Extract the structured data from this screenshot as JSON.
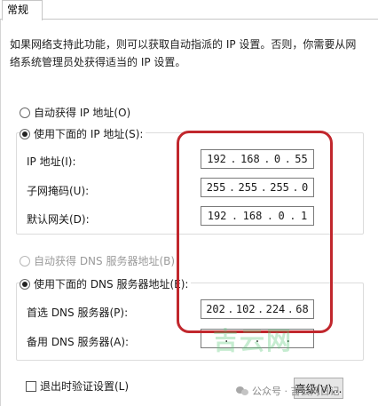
{
  "tab": {
    "label": "常规"
  },
  "description": "如果网络支持此功能，则可以获取自动指派的 IP 设置。否则，你需要从网络系统管理员处获得适当的 IP 设置。",
  "ip_section": {
    "auto_label": "自动获得 IP 地址(O)",
    "manual_label": "使用下面的 IP 地址(S):",
    "ip_address": {
      "label": "IP 地址(I):",
      "octets": [
        "192",
        "168",
        "0",
        "55"
      ]
    },
    "subnet_mask": {
      "label": "子网掩码(U):",
      "octets": [
        "255",
        "255",
        "255",
        "0"
      ]
    },
    "gateway": {
      "label": "默认网关(D):",
      "octets": [
        "192",
        "168",
        "0",
        "1"
      ]
    }
  },
  "dns_section": {
    "auto_label": "自动获得 DNS 服务器地址(B)",
    "manual_label": "使用下面的 DNS 服务器地址(E):",
    "preferred": {
      "label": "首选 DNS 服务器(P):",
      "octets": [
        "202",
        "102",
        "224",
        "68"
      ]
    },
    "alternate": {
      "label": "备用 DNS 服务器(A):",
      "octets": [
        "",
        "",
        "",
        ""
      ]
    }
  },
  "validate_label": "退出时验证设置(L)",
  "advanced_button": "高级(V)...",
  "watermark": {
    "center": "吉云网",
    "corner": "公众号 · 吉云网日记"
  },
  "colors": {
    "highlight": "#c1272d",
    "watermark": "#5ac878"
  }
}
